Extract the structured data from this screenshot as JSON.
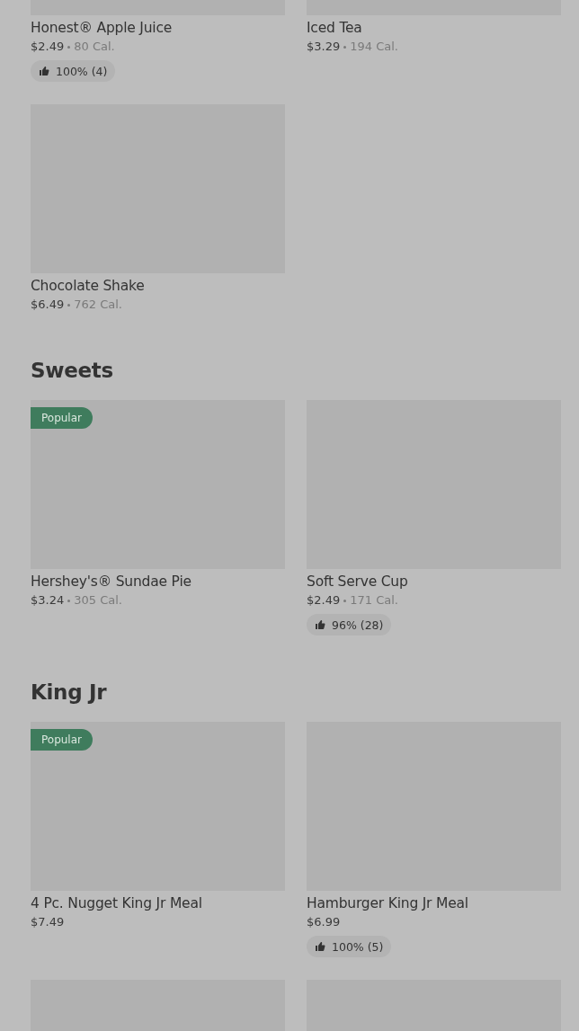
{
  "sections": [
    {
      "items": [
        {
          "kind": "product",
          "name": "Honest® Apple Juice",
          "price": "$2.49",
          "calories": "80 Cal.",
          "rating": "100% (4)"
        },
        {
          "kind": "product",
          "name": "Iced Tea",
          "price": "$3.29",
          "calories": "194 Cal."
        },
        {
          "kind": "product",
          "name": "Chocolate Shake",
          "price": "$6.49",
          "calories": "762 Cal."
        }
      ]
    },
    {
      "title": "Sweets",
      "items": [
        {
          "kind": "product",
          "badge": "Popular",
          "name": "Hershey's® Sundae Pie",
          "price": "$3.24",
          "calories": "305 Cal."
        },
        {
          "kind": "product",
          "name": "Soft Serve Cup",
          "price": "$2.49",
          "calories": "171 Cal.",
          "rating": "96% (28)"
        }
      ]
    },
    {
      "title": "King Jr",
      "items": [
        {
          "kind": "product",
          "badge": "Popular",
          "name": "4 Pc. Nugget King Jr Meal",
          "price": "$7.49"
        },
        {
          "kind": "product",
          "name": "Hamburger King Jr Meal",
          "price": "$6.99",
          "rating": "100% (5)"
        },
        {
          "kind": "picture"
        },
        {
          "kind": "picture"
        }
      ]
    }
  ]
}
